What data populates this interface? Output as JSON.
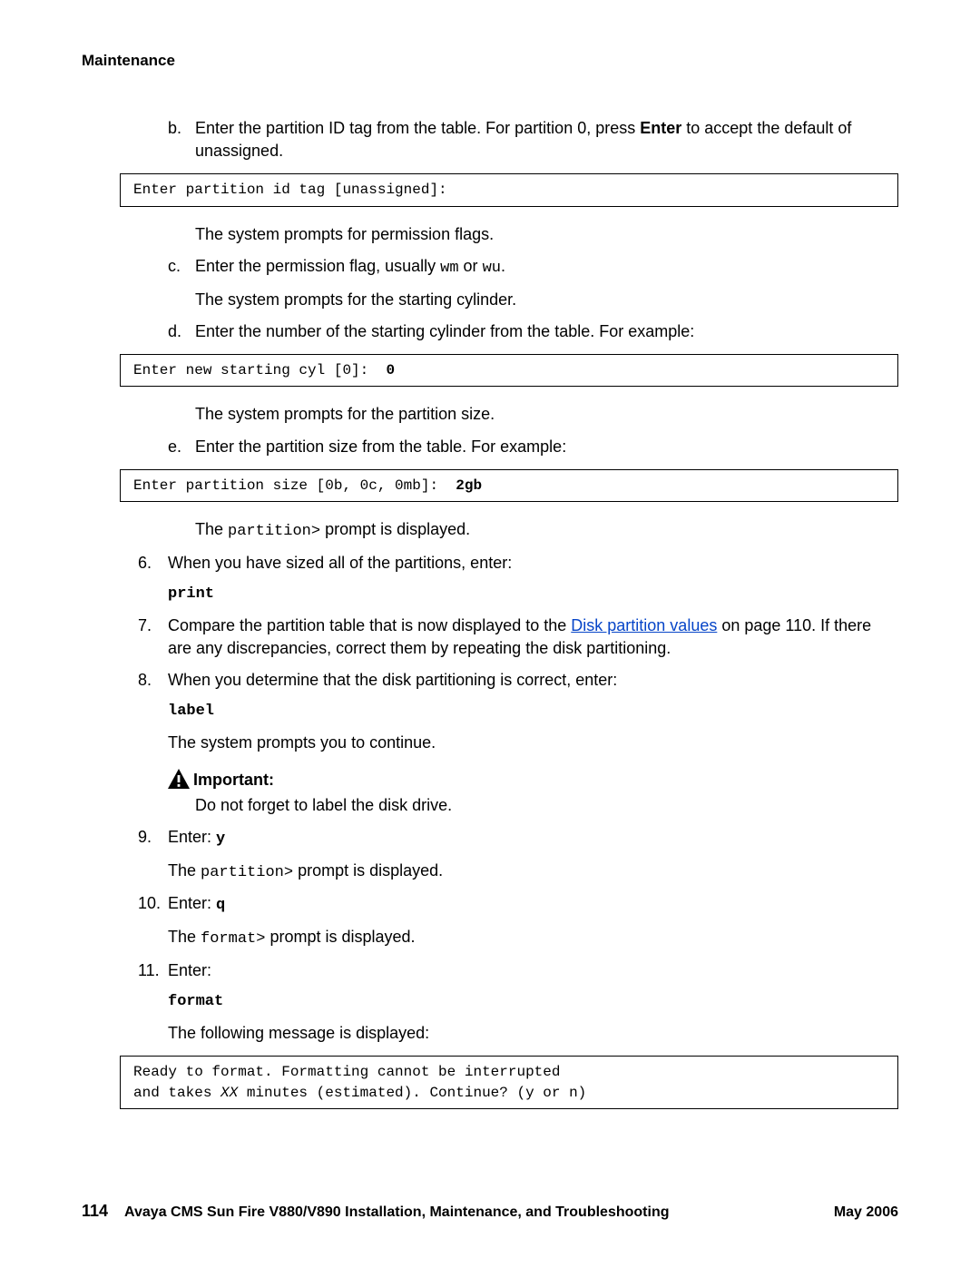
{
  "header": "Maintenance",
  "step_b": {
    "label": "b.",
    "pre": "Enter the partition ID tag from the table. For partition 0, press ",
    "bold": "Enter",
    "post": " to accept the default of unassigned."
  },
  "code_b": "Enter partition id tag [unassigned]:",
  "note_b_after": "The system prompts for permission flags.",
  "step_c": {
    "label": "c.",
    "pre": "Enter the permission flag, usually ",
    "m1": "wm",
    "mid": " or ",
    "m2": "wu",
    "post": "."
  },
  "note_c_after": "The system prompts for the starting cylinder.",
  "step_d": {
    "label": "d.",
    "text": "Enter the number of the starting cylinder from the table. For example:"
  },
  "code_d_pre": "Enter new starting cyl [0]:  ",
  "code_d_bold": "0",
  "note_d_after": "The system prompts for the partition size.",
  "step_e": {
    "label": "e.",
    "text": "Enter the partition size from the table. For example:"
  },
  "code_e_pre": "Enter partition size [0b, 0c, 0mb]:  ",
  "code_e_bold": "2gb",
  "note_e_after_pre": "The ",
  "note_e_after_mono": "partition>",
  "note_e_after_post": " prompt is displayed.",
  "step6": {
    "label": "6.",
    "text": "When you have sized all of the partitions, enter:"
  },
  "step6_cmd": "print",
  "step7": {
    "label": "7.",
    "pre": "Compare the partition table that is now displayed to the ",
    "link": "Disk partition values",
    "post": " on page 110. If there are any discrepancies, correct them by repeating the disk partitioning."
  },
  "step8": {
    "label": "8.",
    "text": "When you determine that the disk partitioning is correct, enter:"
  },
  "step8_cmd": "label",
  "step8_after": "The system prompts you to continue.",
  "important_label": "Important:",
  "important_body": "Do not forget to label the disk drive.",
  "step9": {
    "label": "9.",
    "pre": "Enter: ",
    "cmd": "y"
  },
  "step9_after_pre": "The ",
  "step9_after_mono": "partition>",
  "step9_after_post": " prompt is displayed.",
  "step10": {
    "label": "10.",
    "pre": "Enter: ",
    "cmd": "q"
  },
  "step10_after_pre": "The ",
  "step10_after_mono": "format>",
  "step10_after_post": " prompt is displayed.",
  "step11": {
    "label": "11.",
    "text": "Enter:"
  },
  "step11_cmd": "format",
  "step11_after": "The following message is displayed:",
  "code_final_l1": "Ready to format. Formatting cannot be interrupted",
  "code_final_l2a": "and takes ",
  "code_final_l2it": "XX",
  "code_final_l2b": " minutes (estimated). Continue? (y or n)",
  "footer": {
    "page": "114",
    "title": "Avaya CMS Sun Fire V880/V890 Installation, Maintenance, and Troubleshooting",
    "date": "May 2006"
  }
}
